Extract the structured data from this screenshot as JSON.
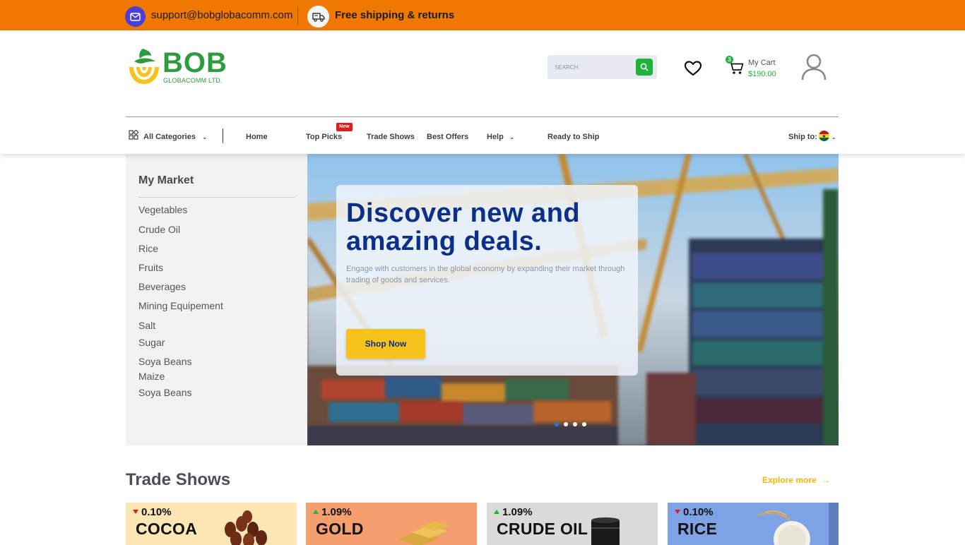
{
  "topbar": {
    "email": "support@bobglobacomm.com",
    "shipping": "Free shipping & returns"
  },
  "logo": {
    "name": "BOB",
    "subtitle": "GLOBACOMM LTD."
  },
  "search": {
    "placeholder": "SEARCH"
  },
  "cart": {
    "count": "3",
    "label": "My Cart",
    "total": "$190.00"
  },
  "nav": {
    "categories": "All Categories",
    "home": "Home",
    "top_picks": "Top Picks",
    "new_badge": "New",
    "trade_shows": "Trade Shows",
    "best_offers": "Best Offers",
    "help": "Help",
    "ready_to_ship": "Ready to Ship",
    "ship_to": "Ship to:"
  },
  "sidebar": {
    "title": "My Market",
    "items": [
      "Vegetables",
      "Crude Oil",
      "Rice",
      "Fruits",
      "Beverages",
      "Mining Equipement",
      "Salt",
      "Sugar",
      "Soya Beans",
      "Maize",
      "Soya Beans"
    ]
  },
  "hero": {
    "title": "Discover new and amazing deals.",
    "subtitle": "Engage with customers in the global economy by expanding their market through trading of goods and services.",
    "button": "Shop Now",
    "slides": 4,
    "active_slide": 1
  },
  "trade_shows": {
    "title": "Trade Shows",
    "explore": "Explore more",
    "cards": [
      {
        "change": "0.10%",
        "direction": "down",
        "name": "COCOA",
        "bg": "#fbe6b4"
      },
      {
        "change": "1.09%",
        "direction": "up",
        "name": "GOLD",
        "bg": "#f59e6e"
      },
      {
        "change": "1.09%",
        "direction": "up",
        "name": "CRUDE OIL",
        "bg": "#dadada"
      },
      {
        "change": "0.10%",
        "direction": "down",
        "name": "RICE",
        "bg": "#7da3e6"
      }
    ]
  },
  "colors": {
    "topbar": "#f07800",
    "brand_green": "#2d9c3c",
    "hero_title": "#0b2f8a",
    "accent_yellow": "#f7c21c"
  }
}
